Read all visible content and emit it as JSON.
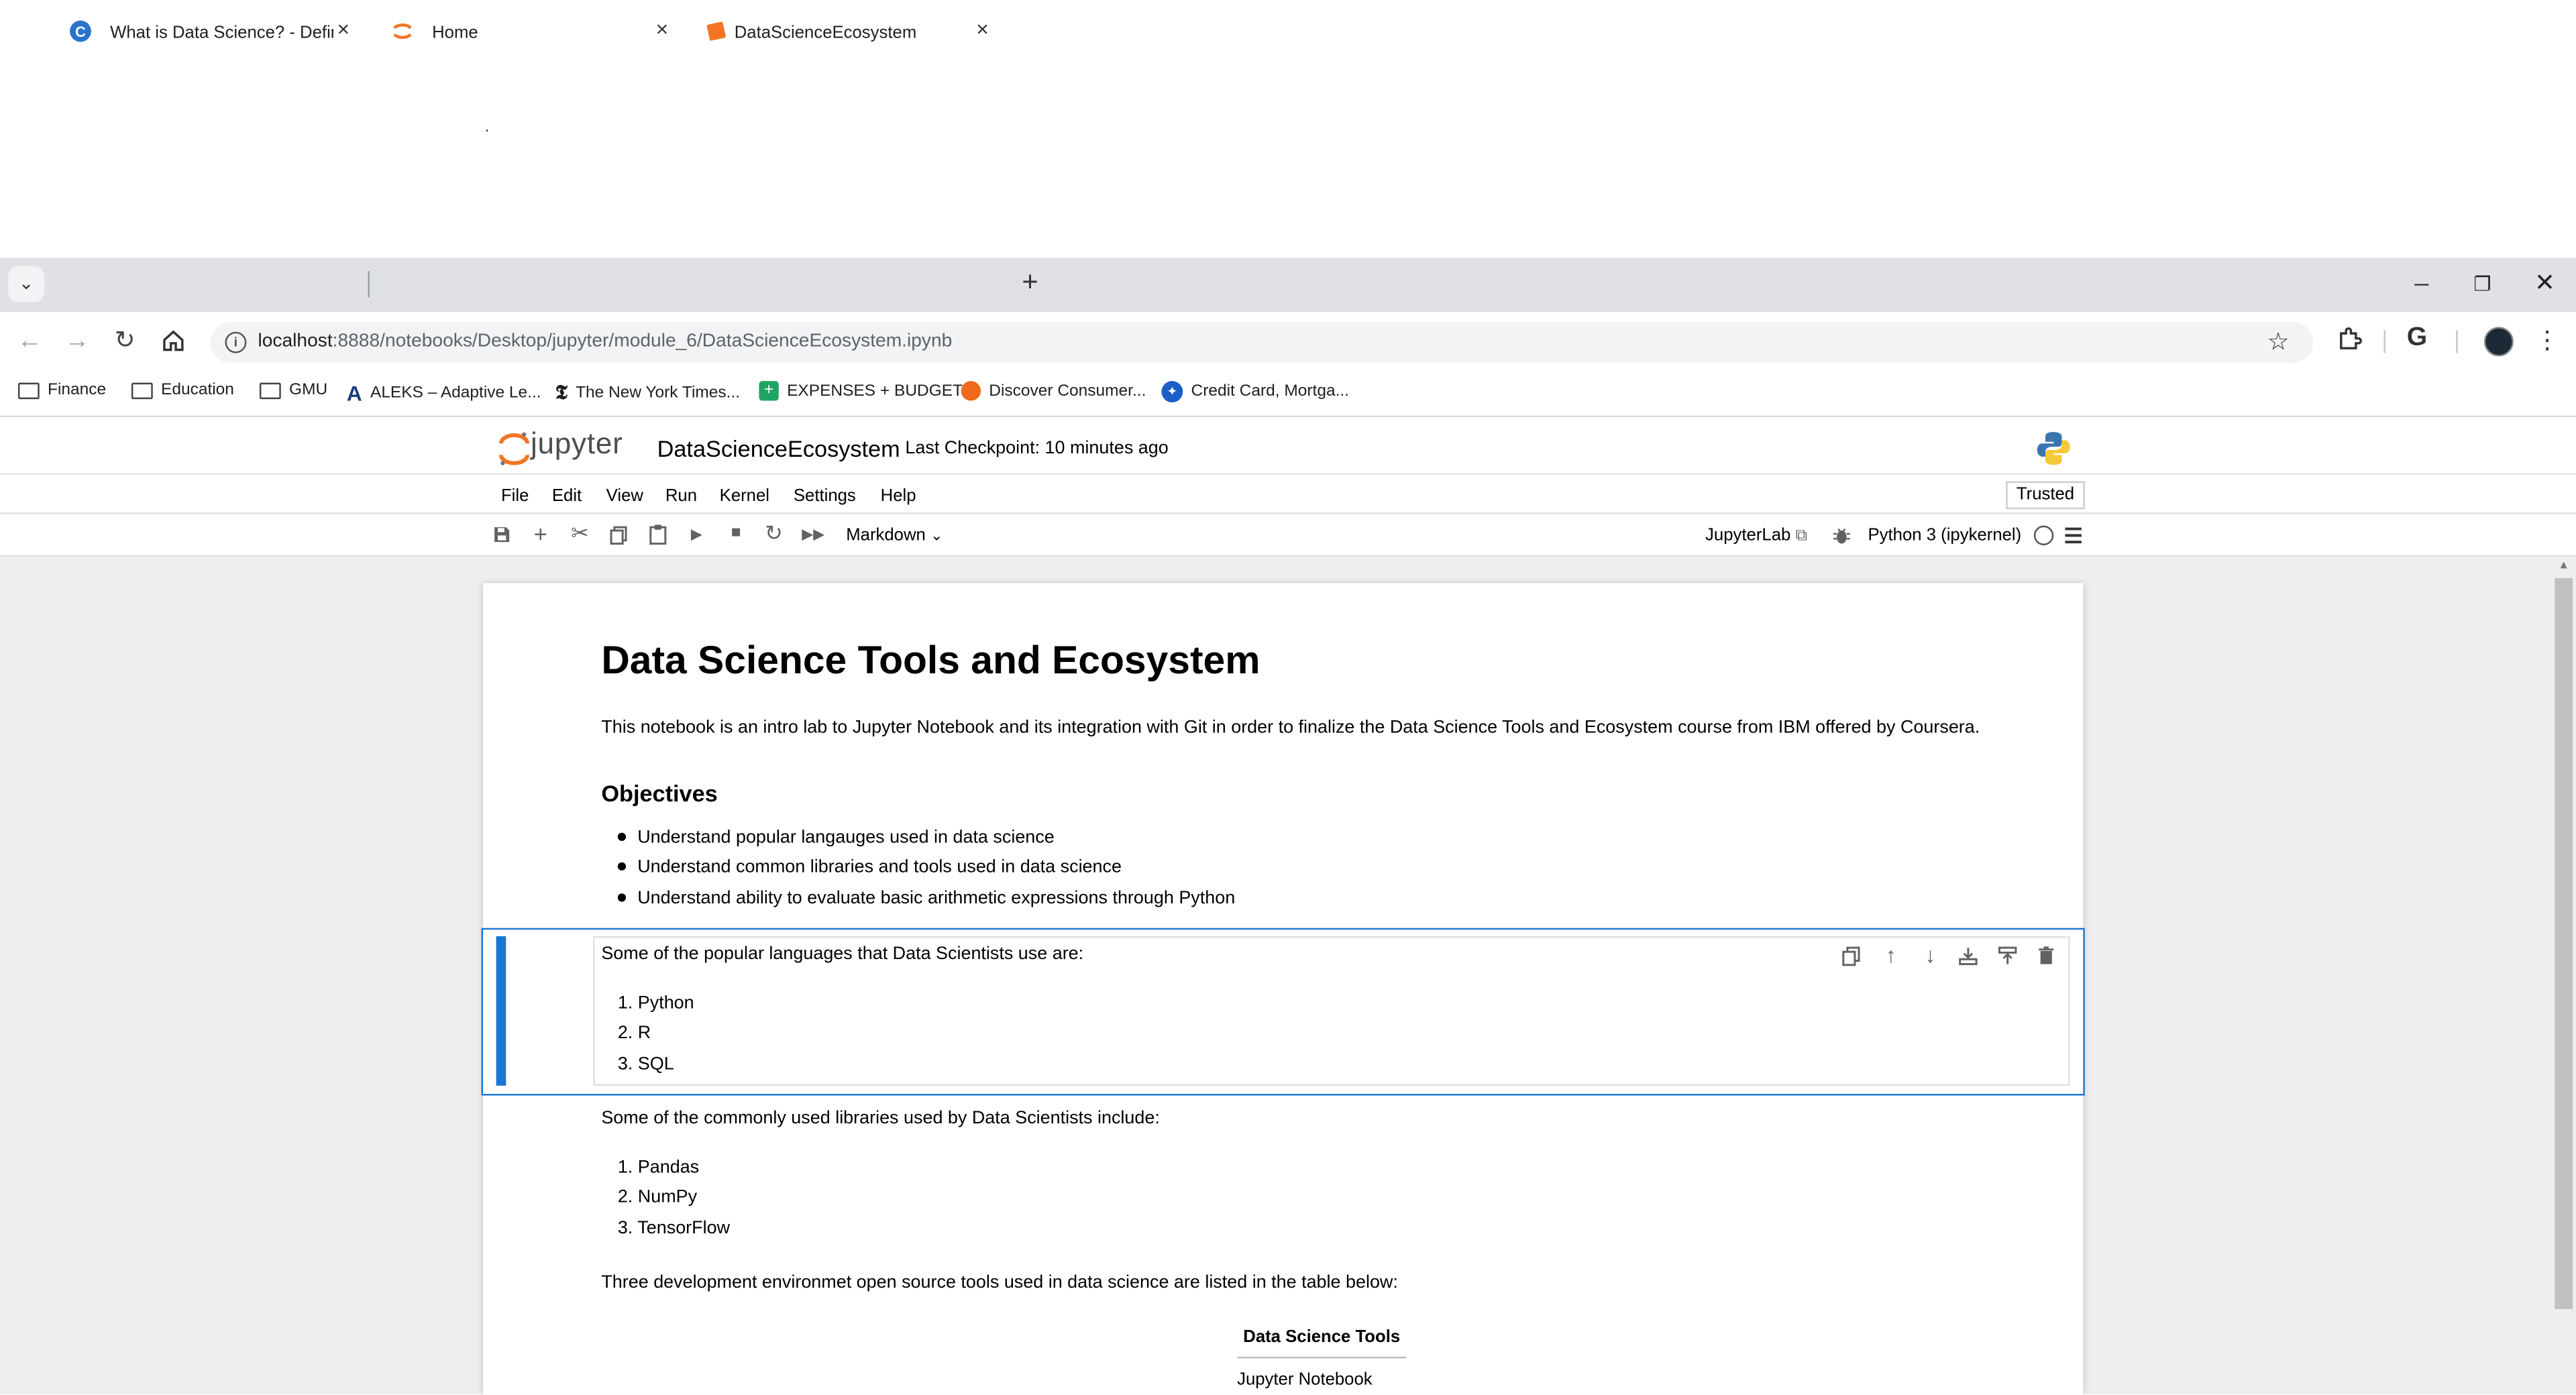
{
  "browser": {
    "tabs": [
      {
        "title": "What is Data Science? - Definin"
      },
      {
        "title": "Home"
      },
      {
        "title": "DataScienceEcosystem"
      }
    ],
    "url_host": "localhost",
    "url_rest": ":8888/notebooks/Desktop/jupyter/module_6/DataScienceEcosystem.ipynb",
    "bookmarks": [
      {
        "label": "Finance"
      },
      {
        "label": "Education"
      },
      {
        "label": "GMU"
      },
      {
        "label": "ALEKS – Adaptive Le..."
      },
      {
        "label": "The New York Times..."
      },
      {
        "label": "EXPENSES + BUDGET"
      },
      {
        "label": "Discover Consumer..."
      },
      {
        "label": "Credit Card, Mortga..."
      }
    ],
    "profile_initial": "G"
  },
  "jupyter": {
    "logo_text": "jupyter",
    "notebook_title": "DataScienceEcosystem",
    "checkpoint": "Last Checkpoint: 10 minutes ago",
    "menu": [
      "File",
      "Edit",
      "View",
      "Run",
      "Kernel",
      "Settings",
      "Help"
    ],
    "trusted": "Trusted",
    "cell_type": "Markdown",
    "jupyterlab_link": "JupyterLab",
    "kernel": "Python 3 (ipykernel)"
  },
  "notebook": {
    "h1": "Data Science Tools and Ecosystem",
    "intro": "This notebook is an intro lab to Jupyter Notebook and its integration with Git in order to finalize the Data Science Tools and Ecosystem course from IBM offered by Coursera.",
    "objectives_heading": "Objectives",
    "objectives": [
      "Understand popular langauges used in data science",
      "Understand common libraries and tools used in data science",
      "Understand ability to evaluate basic arithmetic expressions through Python"
    ],
    "languages_intro": "Some of the popular languages that Data Scientists use are:",
    "languages": [
      "1. Python",
      "2. R",
      "3. SQL"
    ],
    "libraries_intro": "Some of the commonly used libraries used by Data Scientists include:",
    "libraries": [
      "1. Pandas",
      "2. NumPy",
      "3. TensorFlow"
    ],
    "tools_intro": "Three development environmet open source tools used in data science are listed in the table below:",
    "table_header": "Data Science Tools",
    "table_rows": [
      "Jupyter Notebook"
    ]
  },
  "colors": {
    "accent": "#1976d2",
    "jupyter_orange": "#f37626"
  }
}
